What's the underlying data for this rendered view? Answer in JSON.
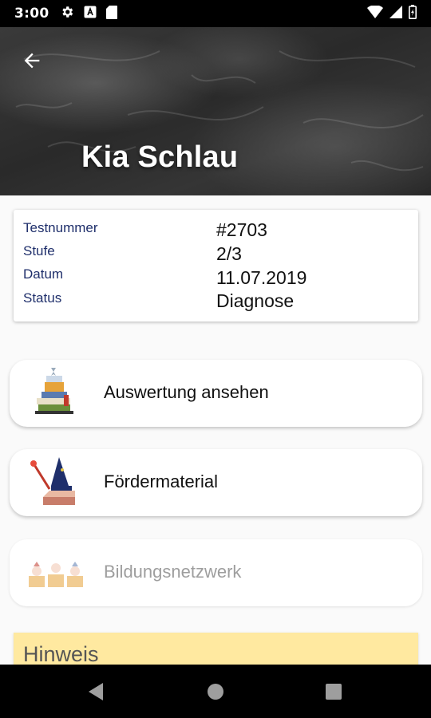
{
  "status_bar": {
    "time": "3:00",
    "left_icons": [
      "gear-icon",
      "font-a-icon",
      "sd-card-icon"
    ],
    "right_icons": [
      "wifi-icon",
      "signal-icon",
      "battery-icon"
    ]
  },
  "header": {
    "title": "Kia Schlau",
    "back_icon": "arrow-back-icon"
  },
  "test_info": {
    "rows": [
      {
        "label": "Testnummer",
        "value": "#2703"
      },
      {
        "label": "Stufe",
        "value": "2/3"
      },
      {
        "label": "Datum",
        "value": "11.07.2019"
      },
      {
        "label": "Status",
        "value": "Diagnose"
      }
    ]
  },
  "menu": {
    "items": [
      {
        "label": "Auswertung ansehen",
        "icon": "books-icon",
        "enabled": true
      },
      {
        "label": "Fördermaterial",
        "icon": "wizard-icon",
        "enabled": true
      },
      {
        "label": "Bildungsnetzwerk",
        "icon": "network-icon",
        "enabled": false
      }
    ]
  },
  "hint": {
    "title": "Hinweis"
  },
  "nav_bar": {
    "buttons": [
      "back-triangle-icon",
      "home-circle-icon",
      "recents-square-icon"
    ]
  },
  "colors": {
    "label_blue": "#1f2f6b",
    "hint_yellow": "#ffe9a0",
    "disabled_grey": "#9e9e9e"
  }
}
